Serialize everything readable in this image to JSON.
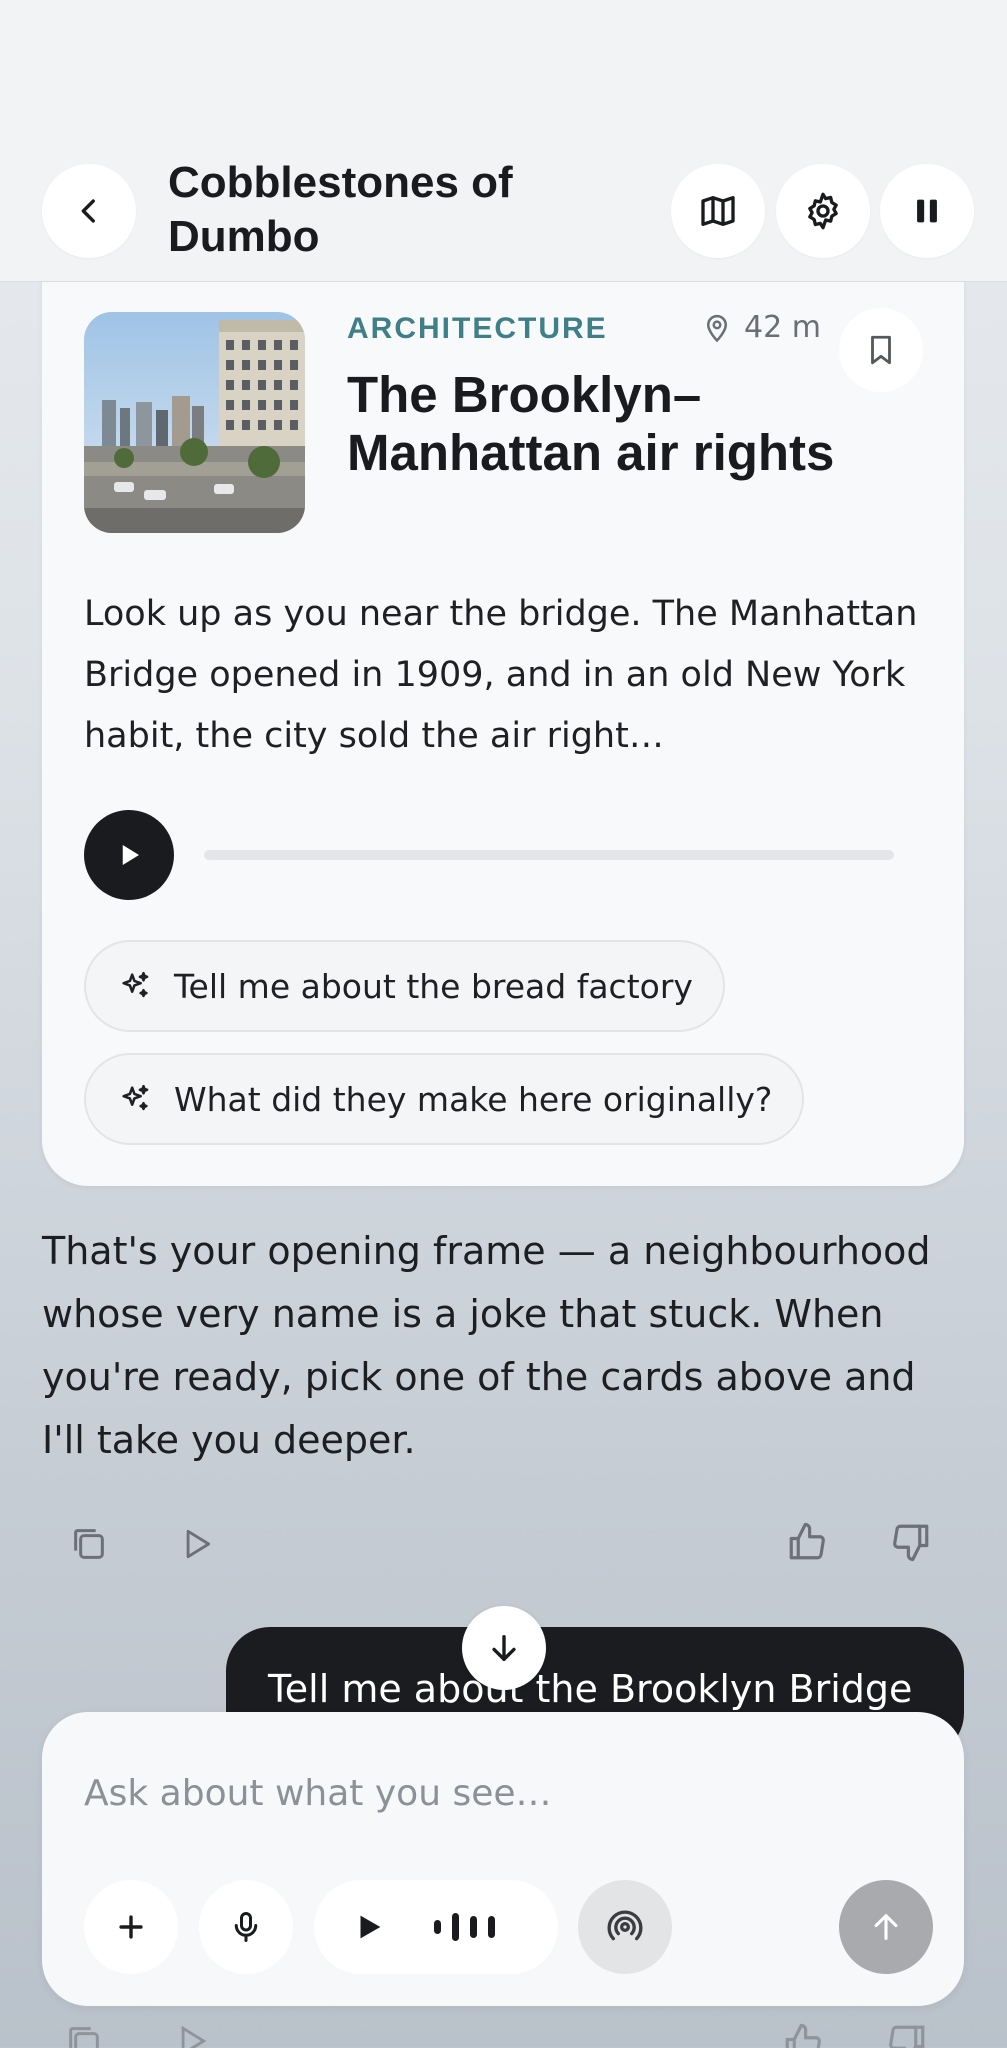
{
  "header": {
    "title": "Cobblestones of Dumbo",
    "back_icon": "chevron-left-icon",
    "map_icon": "map-icon",
    "settings_icon": "gear-icon",
    "pause_icon": "pause-icon"
  },
  "card": {
    "category": "ARCHITECTURE",
    "distance": "42 m",
    "title": "The Brooklyn–Manhattan air rights",
    "body": "Look up as you near the bridge. The Manhattan Bridge opened in 1909, and in an old New York habit, the city sold the air right…",
    "audio_progress": 0,
    "suggestions": [
      {
        "label": "Tell me about the bread factory"
      },
      {
        "label": "What did they make here originally?"
      }
    ]
  },
  "assistant_message": "That's your opening frame — a neighbourhood whose very name is a joke that stuck. When you're ready, pick one of the cards above and I'll take you deeper.",
  "user_message": "Tell me about the Brooklyn Bridge",
  "composer": {
    "placeholder": "Ask about what you see…"
  },
  "colors": {
    "accent_category": "#3f7f88",
    "dark": "#1b1c1f",
    "send_button": "#a9aaad"
  }
}
